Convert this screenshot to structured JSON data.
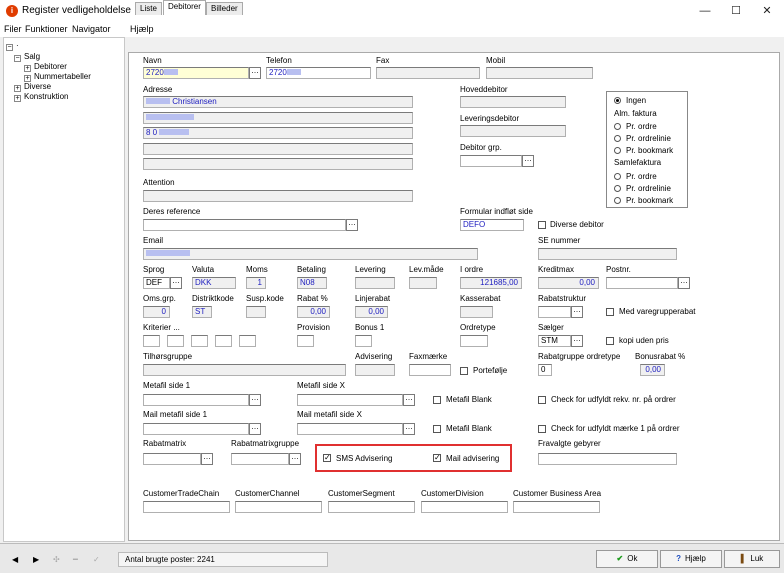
{
  "window": {
    "title": "Register vedligeholdelse",
    "minimize": "—",
    "maximize": "☐",
    "close": "✕"
  },
  "menu": [
    "Filer",
    "Funktioner",
    "Navigator",
    "Hjælp"
  ],
  "tree": {
    "root": "·",
    "items": [
      {
        "label": "Salg",
        "sign": "−"
      },
      {
        "label": "Debitorer",
        "sign": "+"
      },
      {
        "label": "Nummertabeller",
        "sign": "+"
      },
      {
        "label": "Diverse",
        "sign": "+"
      },
      {
        "label": "Konstruktion",
        "sign": "+"
      }
    ]
  },
  "tabs": [
    "Liste",
    "Debitorer",
    "Billeder"
  ],
  "labels": {
    "navn": "Navn",
    "telefon": "Telefon",
    "fax": "Fax",
    "mobil": "Mobil",
    "adresse": "Adresse",
    "hoveddebitor": "Hoveddebitor",
    "leveringsdebitor": "Leveringsdebitor",
    "debitor_grp": "Debitor grp.",
    "attention": "Attention",
    "deres_reference": "Deres reference",
    "formular": "Formular indfløt side",
    "diverse_debitor": "Diverse debitor",
    "email": "Email",
    "se_nummer": "SE nummer",
    "sprog": "Sprog",
    "valuta": "Valuta",
    "moms": "Moms",
    "betaling": "Betaling",
    "levering": "Levering",
    "levmaade": "Lev.måde",
    "i_ordre": "I ordre",
    "kreditmax": "Kreditmax",
    "postnr": "Postnr.",
    "oms_grp": "Oms.grp.",
    "distriktkode": "Distriktkode",
    "susp_kode": "Susp.kode",
    "rabat": "Rabat %",
    "linjerabat": "Linjerabat",
    "kasserabat": "Kasserabat",
    "rabatstruktur": "Rabatstruktur",
    "med_varegrupperabat": "Med varegrupperabat",
    "kriterier": "Kriterier ...",
    "provision": "Provision",
    "bonus1": "Bonus 1",
    "ordretype": "Ordretype",
    "saelger": "Sælger",
    "kopi_uden_pris": "kopi uden pris",
    "tilhoersgruppe": "Tilhørsgruppe",
    "advisering": "Advisering",
    "faxmaerke": "Faxmærke",
    "portefoelje": "Portefølje",
    "rabatgruppe_ordretype": "Rabatgruppe ordretype",
    "bonusrabat": "Bonusrabat %",
    "metafil1": "Metafil side 1",
    "metafilx": "Metafil side X",
    "metafil_blank": "Metafil Blank",
    "check_rekv": "Check for udfyldt rekv. nr. på ordrer",
    "mailmetafil1": "Mail metafil side 1",
    "mailmetafilx": "Mail metafil side X",
    "mailmetafil_blank": "Metafil Blank",
    "check_maerke": "Check for udfyldt mærke 1 på ordrer",
    "rabatmatrix": "Rabatmatrix",
    "rabatmatrixgruppe": "Rabatmatrixgruppe",
    "sms_advisering": "SMS Advisering",
    "mail_advisering": "Mail advisering",
    "fravalgte_gebyrer": "Fravalgte gebyrer",
    "ctc": "CustomerTradeChain",
    "cch": "CustomerChannel",
    "cseg": "CustomerSegment",
    "cdiv": "CustomerDivision",
    "cba": "Customer Business Area"
  },
  "values": {
    "navn": "2720",
    "telefon": "2720",
    "adresse_navn": "Christiansen",
    "adresse3": "8  0",
    "formular": "DEFO",
    "sprog": "DEF",
    "valuta": "DKK",
    "moms": "1",
    "betaling": "N08",
    "i_ordre": "121685,00",
    "kreditmax": "0,00",
    "oms_grp": "0",
    "distriktkode": "ST",
    "rabat": "0,00",
    "linjerabat": "0,00",
    "saelger": "STM",
    "rabatgruppe": "0",
    "bonusrabat": "0,00"
  },
  "checkboxes": {
    "diverse_debitor": false,
    "med_varegrupperabat": false,
    "kopi_uden_pris": false,
    "portefoelje": false,
    "metafil_blank": false,
    "check_rekv": false,
    "mailmetafil_blank": false,
    "check_maerke": false,
    "sms_advisering": true,
    "mail_advisering": true
  },
  "faktura_group": {
    "ingen": "Ingen",
    "alm_faktura": "Alm. faktura",
    "pr_ordre": "Pr. ordre",
    "pr_ordrelinie": "Pr. ordrelinie",
    "pr_bookmark": "Pr. bookmark",
    "samlefaktura": "Samlefaktura",
    "pr_ordre2": "Pr. ordre",
    "pr_ordrelinie2": "Pr. ordrelinie",
    "pr_bookmark2": "Pr. bookmark",
    "selected": "Ingen"
  },
  "status": {
    "text": "Antal brugte poster: 2241"
  },
  "buttons": {
    "ok": "Ok",
    "hjaelp": "Hjælp",
    "luk": "Luk"
  },
  "colors": {
    "accent_red": "#e03030",
    "value_blue": "#2020c0",
    "highlight": "#ffffd6"
  }
}
